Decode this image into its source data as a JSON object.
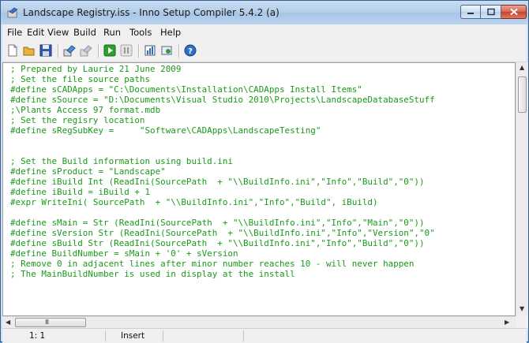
{
  "window": {
    "title": "Landscape Registry.iss - Inno Setup Compiler 5.4.2 (a)",
    "icons": [
      "app-icon",
      "minimize-icon",
      "maximize-icon",
      "close-icon"
    ]
  },
  "menu": {
    "items": [
      "File",
      "Edit",
      "View",
      "Build",
      "Run",
      "Tools",
      "Help"
    ]
  },
  "toolbar": {
    "icons": [
      "new-file-icon",
      "open-folder-icon",
      "save-icon",
      "compile-icon",
      "stop-compile-icon",
      "run-icon",
      "pause-icon",
      "target-icon",
      "options-icon",
      "help-icon"
    ]
  },
  "editor": {
    "lines": [
      "; Prepared by Laurie 21 June 2009",
      "; Set the file source paths",
      "#define sCADApps = \"C:\\Documents\\Installation\\CADApps Install Items\"",
      "#define sSource = \"D:\\Documents\\Visual Studio 2010\\Projects\\LandscapeDatabaseStuff",
      ";\\Plants Access 97 format.mdb",
      "; Set the regisry location",
      "#define sRegSubKey =     \"Software\\CADApps\\LandscapeTesting\"",
      "",
      "",
      "; Set the Build information using build.ini",
      "#define sProduct = \"Landscape\"",
      "#define iBuild Int (ReadIni(SourcePath  + \"\\\\BuildInfo.ini\",\"Info\",\"Build\",\"0\"))",
      "#define iBuild = iBuild + 1",
      "#expr WriteIni( SourcePath  + \"\\\\BuildInfo.ini\",\"Info\",\"Build\", iBuild)",
      "",
      "#define sMain = Str (ReadIni(SourcePath  + \"\\\\BuildInfo.ini\",\"Info\",\"Main\",\"0\"))",
      "#define sVersion Str (ReadIni(SourcePath  + \"\\\\BuildInfo.ini\",\"Info\",\"Version\",\"0\"",
      "#define sBuild Str (ReadIni(SourcePath  + \"\\\\BuildInfo.ini\",\"Info\",\"Build\",\"0\"))",
      "#define BuildNumber = sMain + '0' + sVersion",
      "; Remove 0 in adjacent lines after minor number reaches 10 - will never happen",
      "; The MainBuildNumber is used in display at the install"
    ]
  },
  "scroll": {
    "hthumb_grip": "III"
  },
  "status": {
    "position": "1:  1",
    "mode": "Insert"
  },
  "colors": {
    "code_text": "#1a9a1a",
    "editor_bg": "#ffffff",
    "chrome_bg": "#f0f0f0",
    "titlebar": "#b3cde9",
    "close_button": "#c7432c"
  }
}
